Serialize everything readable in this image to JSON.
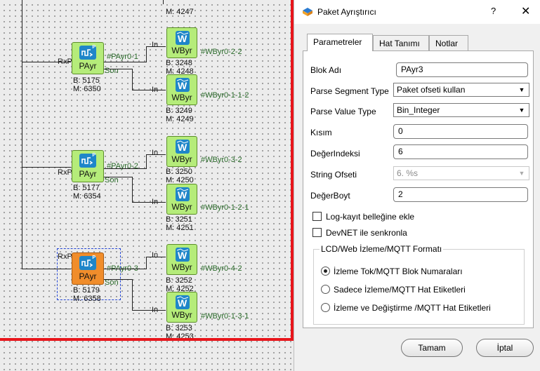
{
  "canvas": {
    "top_block": {
      "m_label": "M: 4247"
    },
    "groups": [
      {
        "payr": {
          "name": "PAyr",
          "b": "B: 5175",
          "m": "M: 6350",
          "in_label": "RxP",
          "out1": "#PAyr0-1",
          "out2": "Son"
        },
        "wbyrs": [
          {
            "name": "WByr",
            "in": "In",
            "tag": "#WByr0-2-2",
            "b": "B: 3248",
            "m": "M: 4248"
          },
          {
            "name": "WByr",
            "in": "In",
            "tag": "#WByr0-1-1-2",
            "b": "B: 3249",
            "m": "M: 4249"
          }
        ]
      },
      {
        "payr": {
          "name": "PAyr",
          "b": "B: 5177",
          "m": "M: 6354",
          "in_label": "RxP",
          "out1": "#PAyr0-2",
          "out2": "Son"
        },
        "wbyrs": [
          {
            "name": "WByr",
            "in": "In",
            "tag": "#WByr0-3-2",
            "b": "B: 3250",
            "m": "M: 4250"
          },
          {
            "name": "WByr",
            "in": "In",
            "tag": "#WByr0-1-2-1",
            "b": "B: 3251",
            "m": "M: 4251"
          }
        ]
      },
      {
        "payr": {
          "name": "PAyr",
          "b": "B: 5179",
          "m": "M: 6358",
          "in_label": "RxP",
          "out1": "#PAyr0-3",
          "out2": "Son",
          "selected": true
        },
        "wbyrs": [
          {
            "name": "WByr",
            "in": "In",
            "tag": "#WByr0-4-2",
            "b": "B: 3252",
            "m": "M: 4252"
          },
          {
            "name": "WByr",
            "in": "In",
            "tag": "#WByr0-1-3-1",
            "b": "B: 3253",
            "m": "M: 4253"
          }
        ]
      }
    ],
    "accent_color": "#e8151b",
    "block_color": "#b5ec7a",
    "selected_block_color": "#f08d2b"
  },
  "dialog": {
    "title": "Paket Ayrıştırıcı",
    "help": "?",
    "close": "✕",
    "tabs": [
      "Parametreler",
      "Hat Tanımı",
      "Notlar"
    ],
    "active_tab": "Parametreler",
    "fields": {
      "blok_adi": {
        "label": "Blok Adı",
        "value": "PAyr3"
      },
      "parse_segment_type": {
        "label": "Parse Segment Type",
        "value": "Paket ofseti kullan"
      },
      "parse_value_type": {
        "label": "Parse Value Type",
        "value": "Bin_Integer"
      },
      "kisim": {
        "label": "Kısım",
        "value": "0"
      },
      "deger_indeksi": {
        "label": "DeğerIndeksi",
        "value": "6"
      },
      "string_ofseti": {
        "label": "String Ofseti",
        "value": "6. %s"
      },
      "deger_boyt": {
        "label": "DeğerBoyt",
        "value": "2"
      }
    },
    "checkboxes": [
      {
        "label": "Log-kayıt belleğine ekle",
        "checked": false
      },
      {
        "label": "DevNET ile senkronla",
        "checked": false
      }
    ],
    "group": {
      "title": "LCD/Web İzleme/MQTT Formatı",
      "options": [
        {
          "label": "İzleme Tok/MQTT Blok Numaraları",
          "selected": true
        },
        {
          "label": "Sadece İzleme/MQTT Hat Etiketleri",
          "selected": false
        },
        {
          "label": "İzleme ve Değiştirme /MQTT Hat Etiketleri",
          "selected": false
        }
      ]
    },
    "buttons": {
      "ok": "Tamam",
      "cancel": "İptal"
    }
  }
}
